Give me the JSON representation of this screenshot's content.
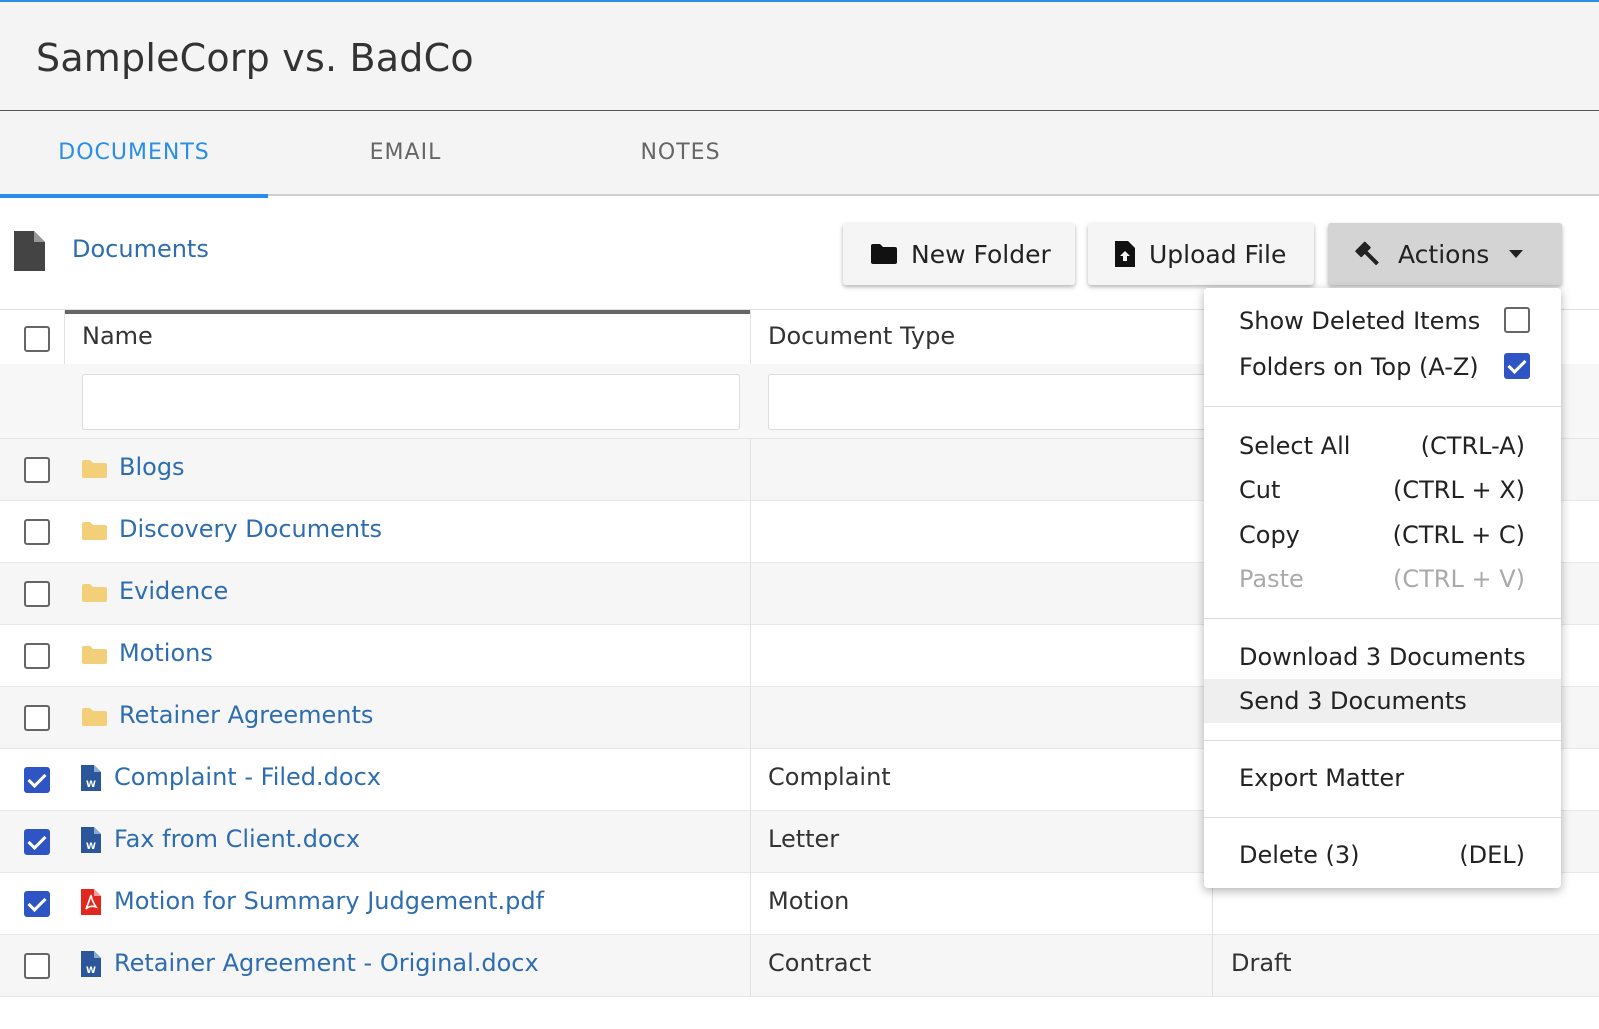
{
  "matter_title": "SampleCorp vs. BadCo",
  "tabs": [
    {
      "label": "DOCUMENTS",
      "active": true
    },
    {
      "label": "EMAIL",
      "active": false
    },
    {
      "label": "NOTES",
      "active": false
    }
  ],
  "breadcrumb": "Documents",
  "toolbar": {
    "new_folder": "New Folder",
    "upload_file": "Upload File",
    "actions": "Actions"
  },
  "columns": {
    "name": "Name",
    "document_type": "Document Type"
  },
  "rows": [
    {
      "kind": "folder",
      "name": "Blogs",
      "type": "",
      "status": "",
      "checked": false
    },
    {
      "kind": "folder",
      "name": "Discovery Documents",
      "type": "",
      "status": "",
      "checked": false
    },
    {
      "kind": "folder",
      "name": "Evidence",
      "type": "",
      "status": "",
      "checked": false
    },
    {
      "kind": "folder",
      "name": "Motions",
      "type": "",
      "status": "",
      "checked": false
    },
    {
      "kind": "folder",
      "name": "Retainer Agreements",
      "type": "",
      "status": "",
      "checked": false
    },
    {
      "kind": "word",
      "name": "Complaint - Filed.docx",
      "type": "Complaint",
      "status": "",
      "checked": true
    },
    {
      "kind": "word",
      "name": "Fax from Client.docx",
      "type": "Letter",
      "status": "",
      "checked": true
    },
    {
      "kind": "pdf",
      "name": "Motion for Summary Judgement.pdf",
      "type": "Motion",
      "status": "",
      "checked": true
    },
    {
      "kind": "word",
      "name": "Retainer Agreement - Original.docx",
      "type": "Contract",
      "status": "Draft",
      "checked": false
    }
  ],
  "actions_menu": {
    "show_deleted": {
      "label": "Show Deleted Items",
      "checked": false
    },
    "folders_on_top": {
      "label": "Folders on Top (A-Z)",
      "checked": true
    },
    "select_all": {
      "label": "Select All",
      "shortcut": "(CTRL-A)"
    },
    "cut": {
      "label": "Cut",
      "shortcut": "(CTRL + X)"
    },
    "copy": {
      "label": "Copy",
      "shortcut": "(CTRL + C)"
    },
    "paste": {
      "label": "Paste",
      "shortcut": "(CTRL + V)",
      "disabled": true
    },
    "download": {
      "label": "Download 3 Documents"
    },
    "send": {
      "label": "Send 3 Documents"
    },
    "export": {
      "label": "Export Matter"
    },
    "delete": {
      "label": "Delete (3)",
      "shortcut": "(DEL)"
    }
  },
  "colors": {
    "accent": "#2a8ee8",
    "link": "#2e6db0",
    "checkbox_checked": "#2f55c4",
    "folder": "#f3cf7a",
    "word_icon": "#2b579a",
    "pdf_icon": "#e3261e"
  }
}
